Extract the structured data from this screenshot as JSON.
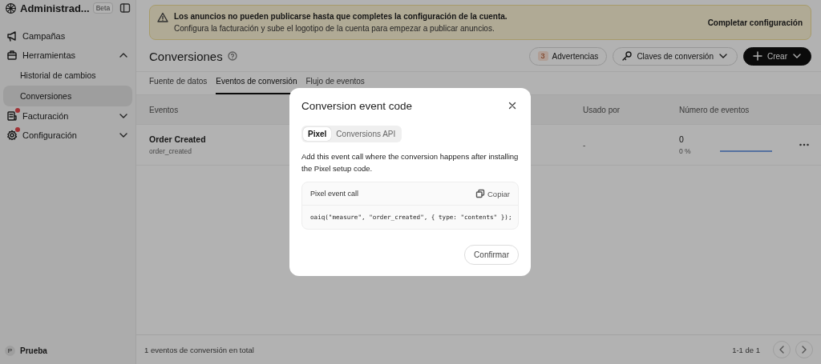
{
  "sidebar": {
    "title": "Administrad...",
    "badge": "Beta",
    "items": [
      {
        "label": "Campañas",
        "selected": false,
        "alert": false
      },
      {
        "label": "Herramientas",
        "selected": false,
        "alert": false,
        "expanded": true,
        "children": [
          {
            "label": "Historial de cambios",
            "selected": false
          },
          {
            "label": "Conversiones",
            "selected": true
          }
        ]
      },
      {
        "label": "Facturación",
        "selected": false,
        "alert": true,
        "expanded": false
      },
      {
        "label": "Configuración",
        "selected": false,
        "alert": true,
        "expanded": false
      }
    ],
    "user": {
      "initial": "P",
      "name": "Prueba"
    }
  },
  "banner": {
    "title": "Los anuncios no pueden publicarse hasta que completes la configuración de la cuenta.",
    "message": "Configura la facturación y sube el logotipo de la cuenta para empezar a publicar anuncios.",
    "action": "Completar configuración"
  },
  "page": {
    "title": "Conversiones",
    "buttons": [
      {
        "kind": "count",
        "count": "3",
        "label": "Advertencias"
      },
      {
        "kind": "keys",
        "label": "Claves de conversión"
      },
      {
        "kind": "primary",
        "label": "Crear"
      }
    ]
  },
  "tabs": [
    {
      "label": "Fuente de datos",
      "selected": false
    },
    {
      "label": "Eventos de conversión",
      "selected": true
    },
    {
      "label": "Flujo de eventos",
      "selected": false
    }
  ],
  "table": {
    "columns": [
      "Eventos",
      "Usado por",
      "Número de eventos"
    ],
    "rows": [
      {
        "name": "Order Created",
        "key": "order_created",
        "used_by": "-",
        "count": "0",
        "percent": "0 %",
        "level": 0
      }
    ]
  },
  "footer": {
    "total": "1 eventos de conversión en total",
    "range": "1-1 de 1"
  },
  "modal": {
    "title": "Conversion event code",
    "segments": [
      {
        "label": "Pixel",
        "selected": true
      },
      {
        "label": "Conversions API",
        "selected": false
      }
    ],
    "description": "Add this event call where the conversion happens after installing the Pixel setup code.",
    "code_card": {
      "label": "Pixel event call",
      "copy": "Copiar",
      "code": "oaiq(\"measure\", \"order_created\", { type: \"contents\" });"
    },
    "confirm": "Confirmar"
  }
}
